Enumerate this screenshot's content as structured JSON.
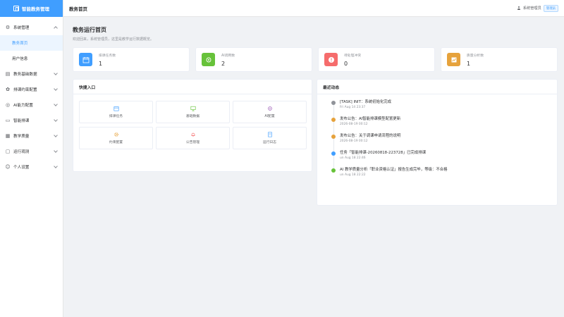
{
  "brand": {
    "title": "智能教务管理"
  },
  "sidebar": {
    "items": [
      {
        "label": "系统管理",
        "icon": "gear-icon",
        "expanded": true
      },
      {
        "label": "教务基础数据",
        "icon": "document-icon",
        "expanded": false
      },
      {
        "label": "排课约束配置",
        "icon": "settings-icon",
        "expanded": false
      },
      {
        "label": "AI能力配置",
        "icon": "ai-icon",
        "expanded": false
      },
      {
        "label": "智能排课",
        "icon": "schedule-icon",
        "expanded": false
      },
      {
        "label": "教学质量",
        "icon": "quality-icon",
        "expanded": false
      },
      {
        "label": "运行观测",
        "icon": "monitor-icon",
        "expanded": false
      },
      {
        "label": "个人设置",
        "icon": "user-icon",
        "expanded": false
      }
    ],
    "submenu": [
      {
        "label": "教务首页",
        "active": true
      },
      {
        "label": "用户信息",
        "active": false
      }
    ]
  },
  "topbar": {
    "title": "教务首页",
    "username": "系统管理员",
    "role": "管理员"
  },
  "main": {
    "title": "教务运行首页",
    "subtitle": "欢迎回来，系统管理员，这里是教学运行数据概览。"
  },
  "stats": [
    {
      "label": "排课任务数",
      "value": "1",
      "color": "#409eff",
      "icon": "calendar-icon"
    },
    {
      "label": "AI调用数",
      "value": "2",
      "color": "#67c23a",
      "icon": "ai-icon"
    },
    {
      "label": "待处理冲突",
      "value": "0",
      "color": "#f56c6c",
      "icon": "alert-icon"
    },
    {
      "label": "质量分析数",
      "value": "1",
      "color": "#e6a23c",
      "icon": "chart-icon"
    }
  ],
  "quick": {
    "title": "快捷入口",
    "items": [
      {
        "label": "排课任务",
        "icon": "calendar-icon",
        "color": "#409eff"
      },
      {
        "label": "基础数据",
        "icon": "monitor-icon",
        "color": "#67c23a"
      },
      {
        "label": "AI配置",
        "icon": "ai-icon",
        "color": "#9b59b6"
      },
      {
        "label": "约束配置",
        "icon": "gear-icon",
        "color": "#e6a23c"
      },
      {
        "label": "公告管理",
        "icon": "bell-icon",
        "color": "#f56c6c"
      },
      {
        "label": "运行日志",
        "icon": "document-icon",
        "color": "#409eff"
      }
    ]
  },
  "recent": {
    "title": "最近动态",
    "items": [
      {
        "text": "[TASK] INIT：系统初始化完成",
        "time": "Fri Aug 14 23:37",
        "color": "#909399"
      },
      {
        "text": "发布公告：AI智能排课模型配置更新",
        "time": "2026-08-19 00:12",
        "color": "#e6a23c"
      },
      {
        "text": "发布公告：关于调课申请流程的说明",
        "time": "2026-08-19 00:12",
        "color": "#e6a23c"
      },
      {
        "text": "任务「智能排课-20260818-223728」已完成排课",
        "time": "un Aug 18 22:46",
        "color": "#409eff"
      },
      {
        "text": "AI 教学质量分析「职业资格认证」报告生成完毕，等级：不合格",
        "time": "un Aug 18 22:22",
        "color": "#67c23a"
      }
    ]
  }
}
